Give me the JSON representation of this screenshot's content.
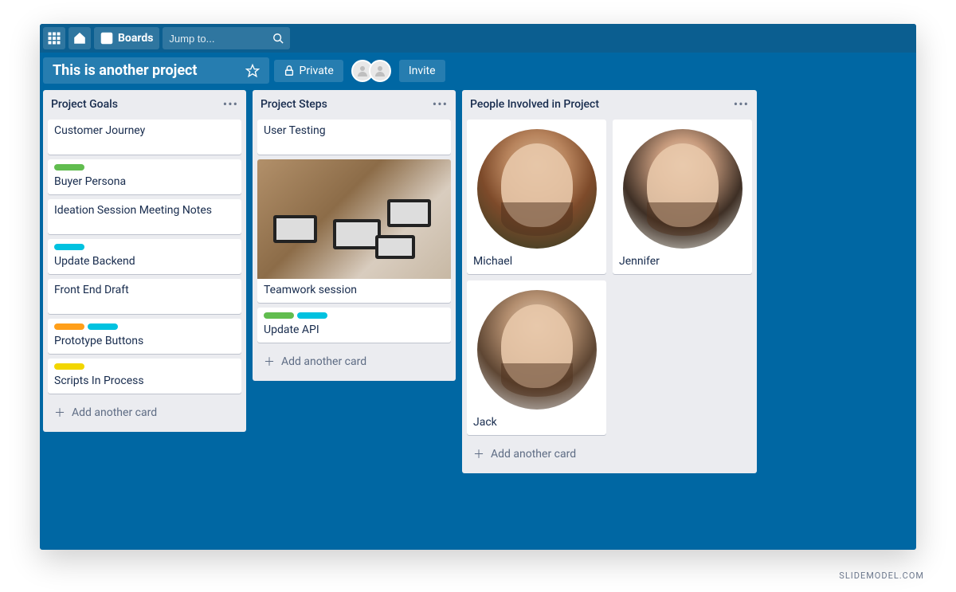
{
  "topbar": {
    "boards_label": "Boards",
    "search_placeholder": "Jump to..."
  },
  "board_header": {
    "title": "This is another project",
    "privacy": "Private",
    "invite": "Invite"
  },
  "lists": [
    {
      "title": "Project Goals",
      "add_label": "Add another card",
      "cards": [
        {
          "title": "Customer Journey",
          "labels": [],
          "tall": true
        },
        {
          "title": "Buyer Persona",
          "labels": [
            "green"
          ]
        },
        {
          "title": "Ideation Session Meeting Notes",
          "labels": [],
          "tall": true
        },
        {
          "title": "Update Backend",
          "labels": [
            "blue"
          ]
        },
        {
          "title": "Front End Draft",
          "labels": [],
          "tall": true
        },
        {
          "title": "Prototype Buttons",
          "labels": [
            "orange",
            "blue"
          ]
        },
        {
          "title": "Scripts In Process",
          "labels": [
            "yellow"
          ]
        }
      ]
    },
    {
      "title": "Project Steps",
      "add_label": "Add another card",
      "cards": [
        {
          "title": "User Testing",
          "labels": [],
          "tall": true
        },
        {
          "title": "Teamwork session",
          "labels": [],
          "cover": true
        },
        {
          "title": "Update API",
          "labels": [
            "green",
            "blue"
          ]
        }
      ]
    },
    {
      "title": "People Involved in Project",
      "add_label": "Add another card",
      "people": [
        {
          "name": "Michael"
        },
        {
          "name": "Jennifer"
        },
        {
          "name": "Jack"
        }
      ]
    }
  ],
  "watermark": "SLIDEMODEL.COM"
}
